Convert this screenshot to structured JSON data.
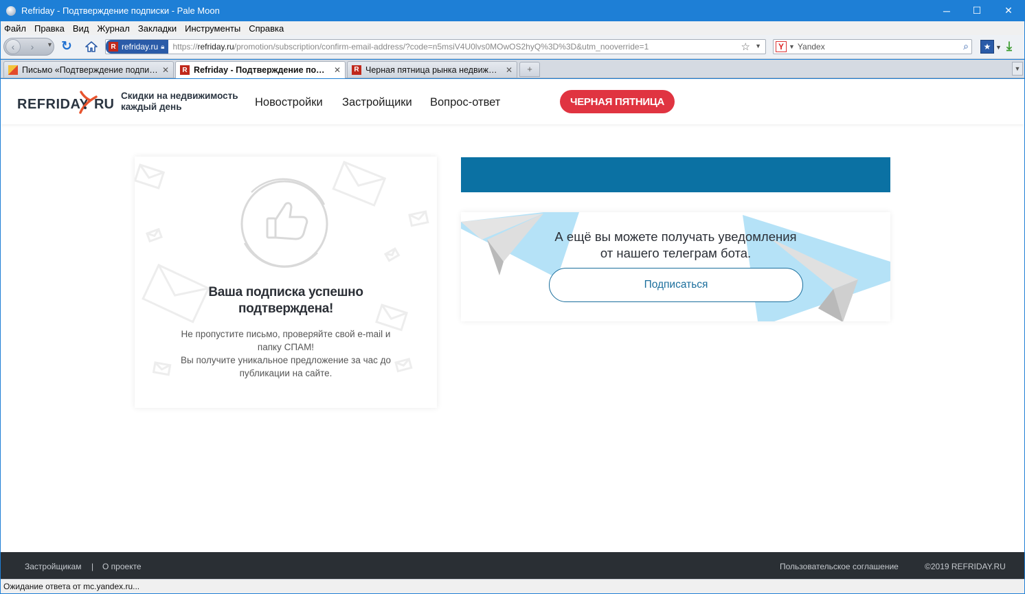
{
  "window": {
    "title": "Refriday - Подтверждение подписки - Pale Moon",
    "minimize": "─",
    "maximize": "☐",
    "close": "✕"
  },
  "menu": [
    "Файл",
    "Правка",
    "Вид",
    "Журнал",
    "Закладки",
    "Инструменты",
    "Справка"
  ],
  "navbar": {
    "site_identity": "refriday.ru",
    "url_scheme": "https://",
    "url_host": "refriday.ru",
    "url_path": "/promotion/subscription/confirm-email-address/?code=n5msiV4U0lvs0MOwOS2hyQ%3D%3D&utm_nooverride=1",
    "search_engine": "Yandex",
    "icons": [
      "back-icon",
      "forward-icon",
      "reload-icon",
      "home-icon",
      "bookmark-star-icon",
      "search-icon",
      "bookmarks-icon",
      "download-icon"
    ]
  },
  "tabs": [
    {
      "label": "Письмо «Подтверждение подписки» — Refriday — Яндекс.Почта",
      "favicon": "mail",
      "active": false
    },
    {
      "label": "Refriday - Подтверждение подписки",
      "favicon": "R",
      "active": true
    },
    {
      "label": "Черная пятница рынка недвижимости",
      "favicon": "R",
      "active": false
    }
  ],
  "site": {
    "tagline_line1": "Скидки на недвижимость",
    "tagline_line2": "каждый день",
    "nav": [
      "Новостройки",
      "Застройщики",
      "Вопрос-ответ"
    ],
    "promo_button": "ЧЕРНАЯ ПЯТНИЦА",
    "brand_colors": {
      "accent_red": "#e03441",
      "blue": "#0b71a3",
      "logo_orange": "#e8542e"
    }
  },
  "success_card": {
    "title_line1": "Ваша подписка успешно",
    "title_line2": "подтверждена!",
    "text_line1": "Не пропустите письмо, проверяйте свой e-mail и",
    "text_line2": "папку СПАМ!",
    "text_line3": "Вы получите уникальное предложение за час до",
    "text_line4": "публикации на сайте.",
    "icon": "thumbs-up-icon"
  },
  "telegram_card": {
    "text_line1": "А ещё вы можете получать уведомления",
    "text_line2": "от нашего телеграм бота.",
    "button": "Подписаться"
  },
  "footer": {
    "links": [
      "Застройщикам",
      "О проекте"
    ],
    "separator": "|",
    "agreement": "Пользовательское соглашение",
    "copyright": "©2019 REFRIDAY.RU"
  },
  "status": "Ожидание ответа от mc.yandex.ru..."
}
